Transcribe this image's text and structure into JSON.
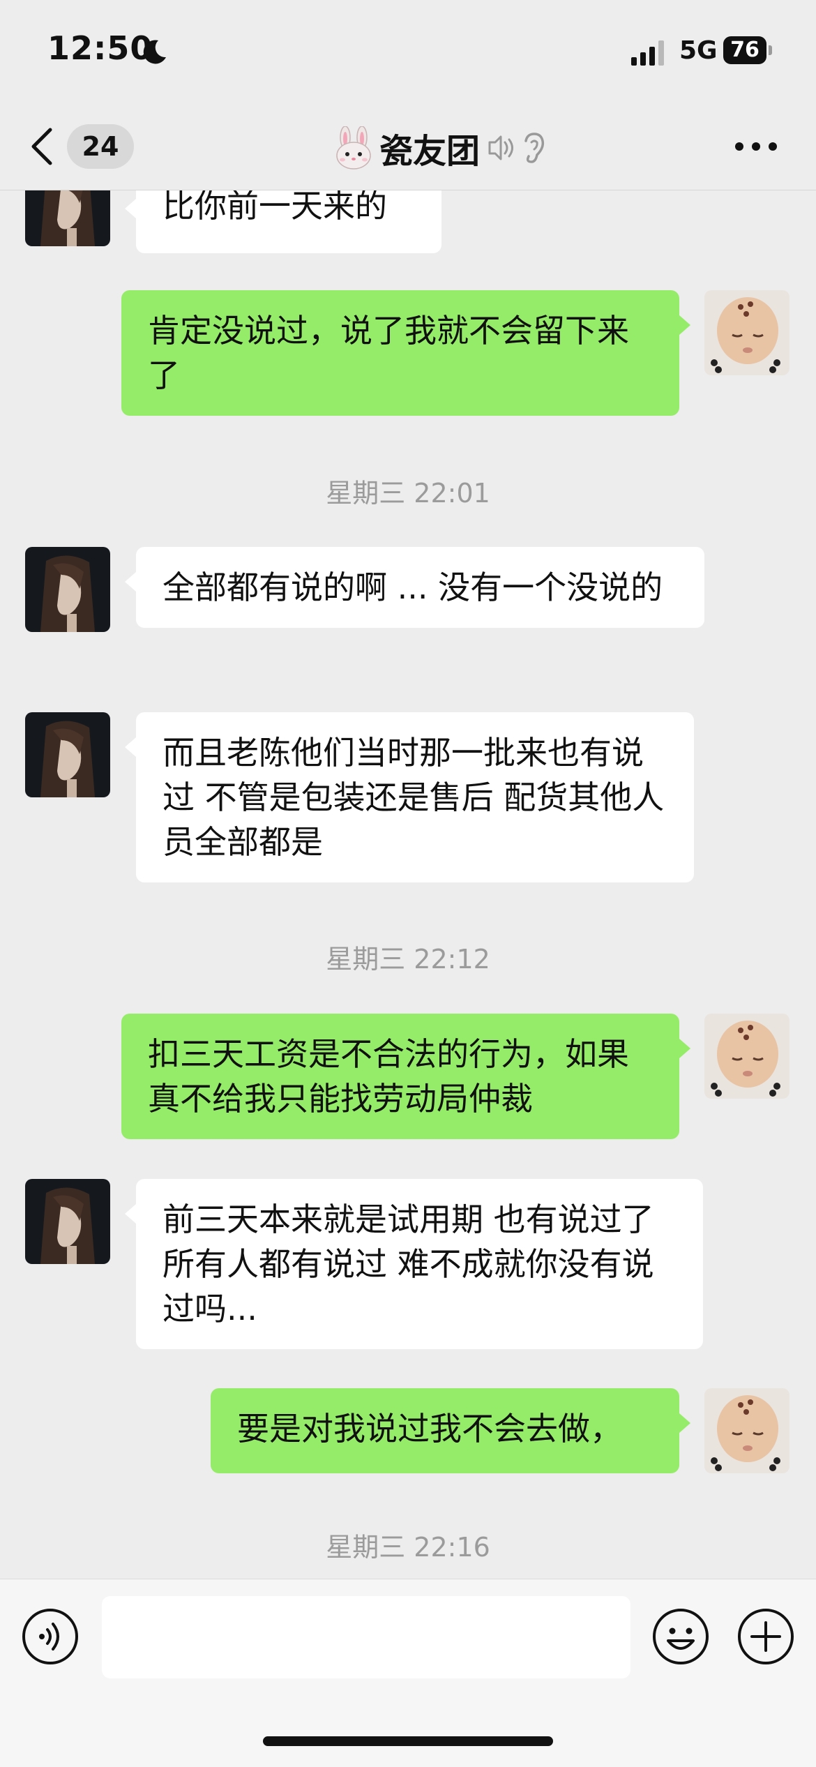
{
  "status_bar": {
    "time": "12:50",
    "network": "5G",
    "battery": "76"
  },
  "header": {
    "back_count": "24",
    "title": "瓷友团"
  },
  "messages": [
    {
      "side": "in",
      "text": "比你前一天来的"
    },
    {
      "side": "out",
      "text": "肯定没说过，说了我就不会留下来了"
    },
    {
      "type": "time",
      "text": "星期三 22:01"
    },
    {
      "side": "in",
      "text": "全部都有说的啊 ... 没有一个没说的"
    },
    {
      "side": "in",
      "text": "而且老陈他们当时那一批来也有说过 不管是包装还是售后 配货其他人员全部都是"
    },
    {
      "type": "time",
      "text": "星期三 22:12"
    },
    {
      "side": "out",
      "text": "扣三天工资是不合法的行为，如果真不给我只能找劳动局仲裁"
    },
    {
      "side": "in",
      "text": "前三天本来就是试用期 也有说过了 所有人都有说过 难不成就你没有说过吗..."
    },
    {
      "side": "out",
      "text": "要是对我说过我不会去做，"
    },
    {
      "type": "time",
      "text": "星期三 22:16"
    }
  ],
  "input": {
    "value": ""
  },
  "colors": {
    "background": "#ededed",
    "outgoing_bubble": "#95ec69",
    "incoming_bubble": "#ffffff",
    "timestamp": "#9b9b9b"
  }
}
